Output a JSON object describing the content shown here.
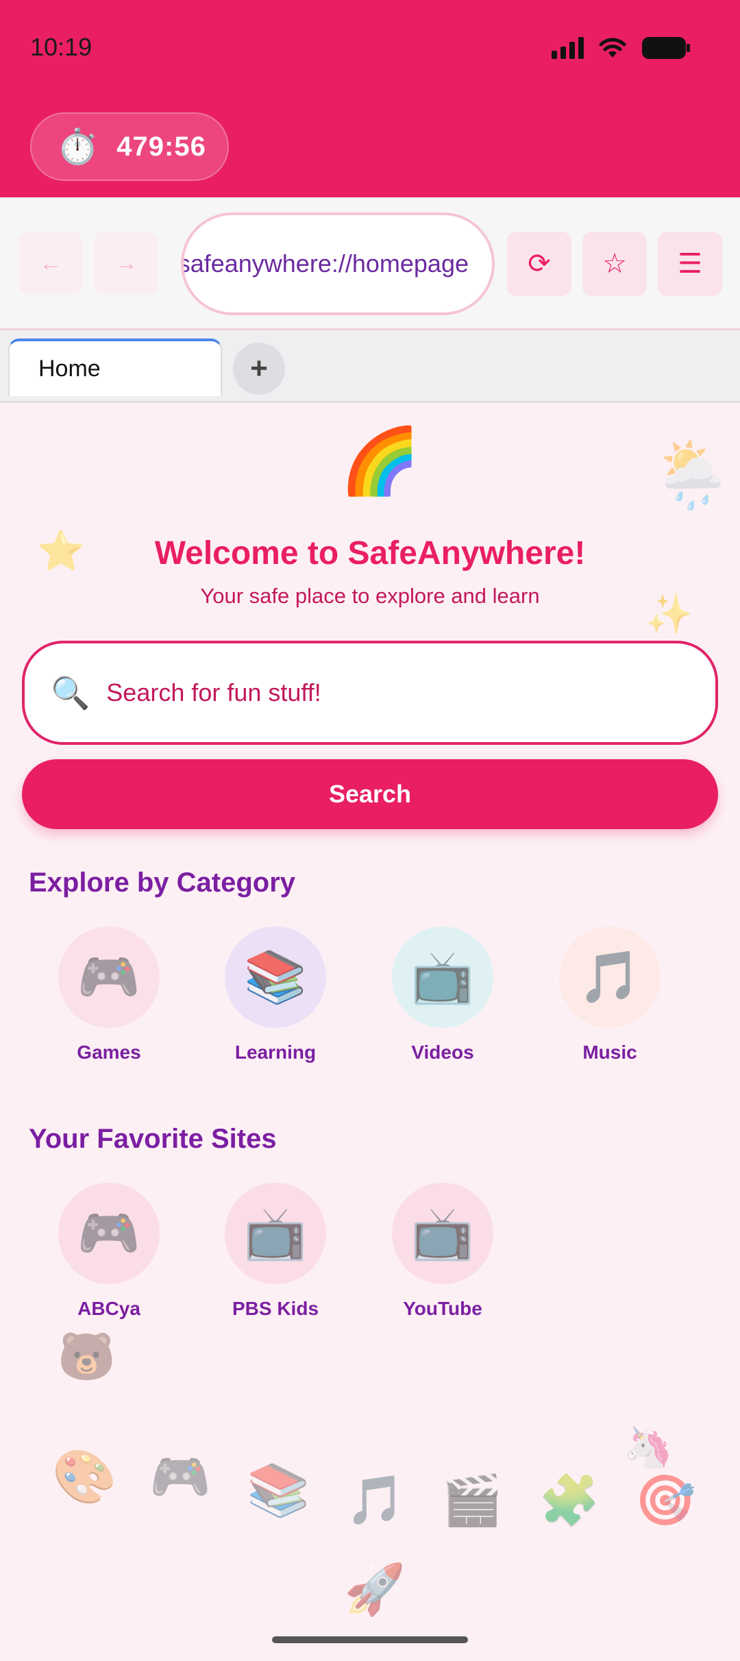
{
  "status_bar": {
    "time": "10:19"
  },
  "timer": {
    "icon": "stopwatch-icon",
    "glyph": "⏱️",
    "value": "479:56"
  },
  "toolbar": {
    "back_glyph": "←",
    "forward_glyph": "→",
    "url": "safeanywhere://homepage",
    "reload_glyph": "⟳",
    "bookmark_glyph": "☆",
    "menu_glyph": "☰"
  },
  "tabs": [
    {
      "label": "Home"
    }
  ],
  "new_tab_glyph": "+",
  "welcome": {
    "title": "Welcome to SafeAnywhere!",
    "subtitle": "Your safe place to explore and learn"
  },
  "search": {
    "icon_glyph": "🔍",
    "placeholder": "Search for fun stuff!",
    "button_label": "Search"
  },
  "categories": {
    "title": "Explore by Category",
    "items": [
      {
        "label": "Games",
        "glyph": "🎮",
        "color": "#fbe0e9"
      },
      {
        "label": "Learning",
        "glyph": "📚",
        "color": "#ece0f6"
      },
      {
        "label": "Videos",
        "glyph": "📺",
        "color": "#e0f1f3"
      },
      {
        "label": "Music",
        "glyph": "🎵",
        "color": "#fde9e6"
      }
    ]
  },
  "favorites": {
    "title": "Your Favorite Sites",
    "items": [
      {
        "label": "ABCya",
        "glyph": "🎮",
        "color": "#fbdde7"
      },
      {
        "label": "PBS Kids",
        "glyph": "📺",
        "color": "#fbdde7"
      },
      {
        "label": "YouTube",
        "glyph": "📺",
        "color": "#fbdde7"
      }
    ]
  },
  "decorations": {
    "rainbow": "🌈",
    "sun_rainbow": "🌦️",
    "star": "⭐",
    "sparkles": "✨",
    "bear": "🐻",
    "unicorn": "🦄",
    "palette": "🎨",
    "gamepad": "🎮",
    "books": "📚",
    "music": "🎵",
    "clapper": "🎬",
    "puzzle": "🧩",
    "target": "🎯",
    "rocket": "🚀"
  },
  "colors": {
    "primary": "#e91e63",
    "accent_purple": "#7b1fa2",
    "background": "#fdf0f4"
  }
}
